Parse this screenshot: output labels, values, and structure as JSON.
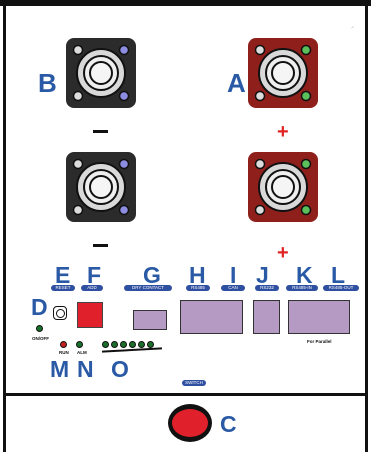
{
  "labels": {
    "terminal_b": "B",
    "terminal_a": "A",
    "terminal_c": "C",
    "minus_sign": "—",
    "plus_sign": "+",
    "d": "D",
    "e": "E",
    "f": "F",
    "g": "G",
    "h": "H",
    "i": "I",
    "j": "J",
    "k": "K",
    "l": "L",
    "m": "M",
    "n": "N",
    "o": "O"
  },
  "port_tags": {
    "reset": "RESET",
    "add": "ADD",
    "dry_contact": "DRY CONTACT",
    "rs485": "RS485",
    "can": "CAN",
    "rs232": "RS232",
    "rs485_in": "RS485-IN",
    "rs485_out": "RS485-OUT",
    "switch": "SWITCH"
  },
  "indicator_labels": {
    "on_off": "ON/OFF",
    "run": "RUN",
    "alm": "ALM",
    "for_parallel": "For Parallel"
  },
  "colors": {
    "accent_blue": "#2a5aa6",
    "terminal_negative": "#2b2b2b",
    "terminal_positive": "#8e1f1b",
    "port_purple": "#b59ac3",
    "button_red": "#e0202a",
    "plus_red": "#e02424"
  }
}
